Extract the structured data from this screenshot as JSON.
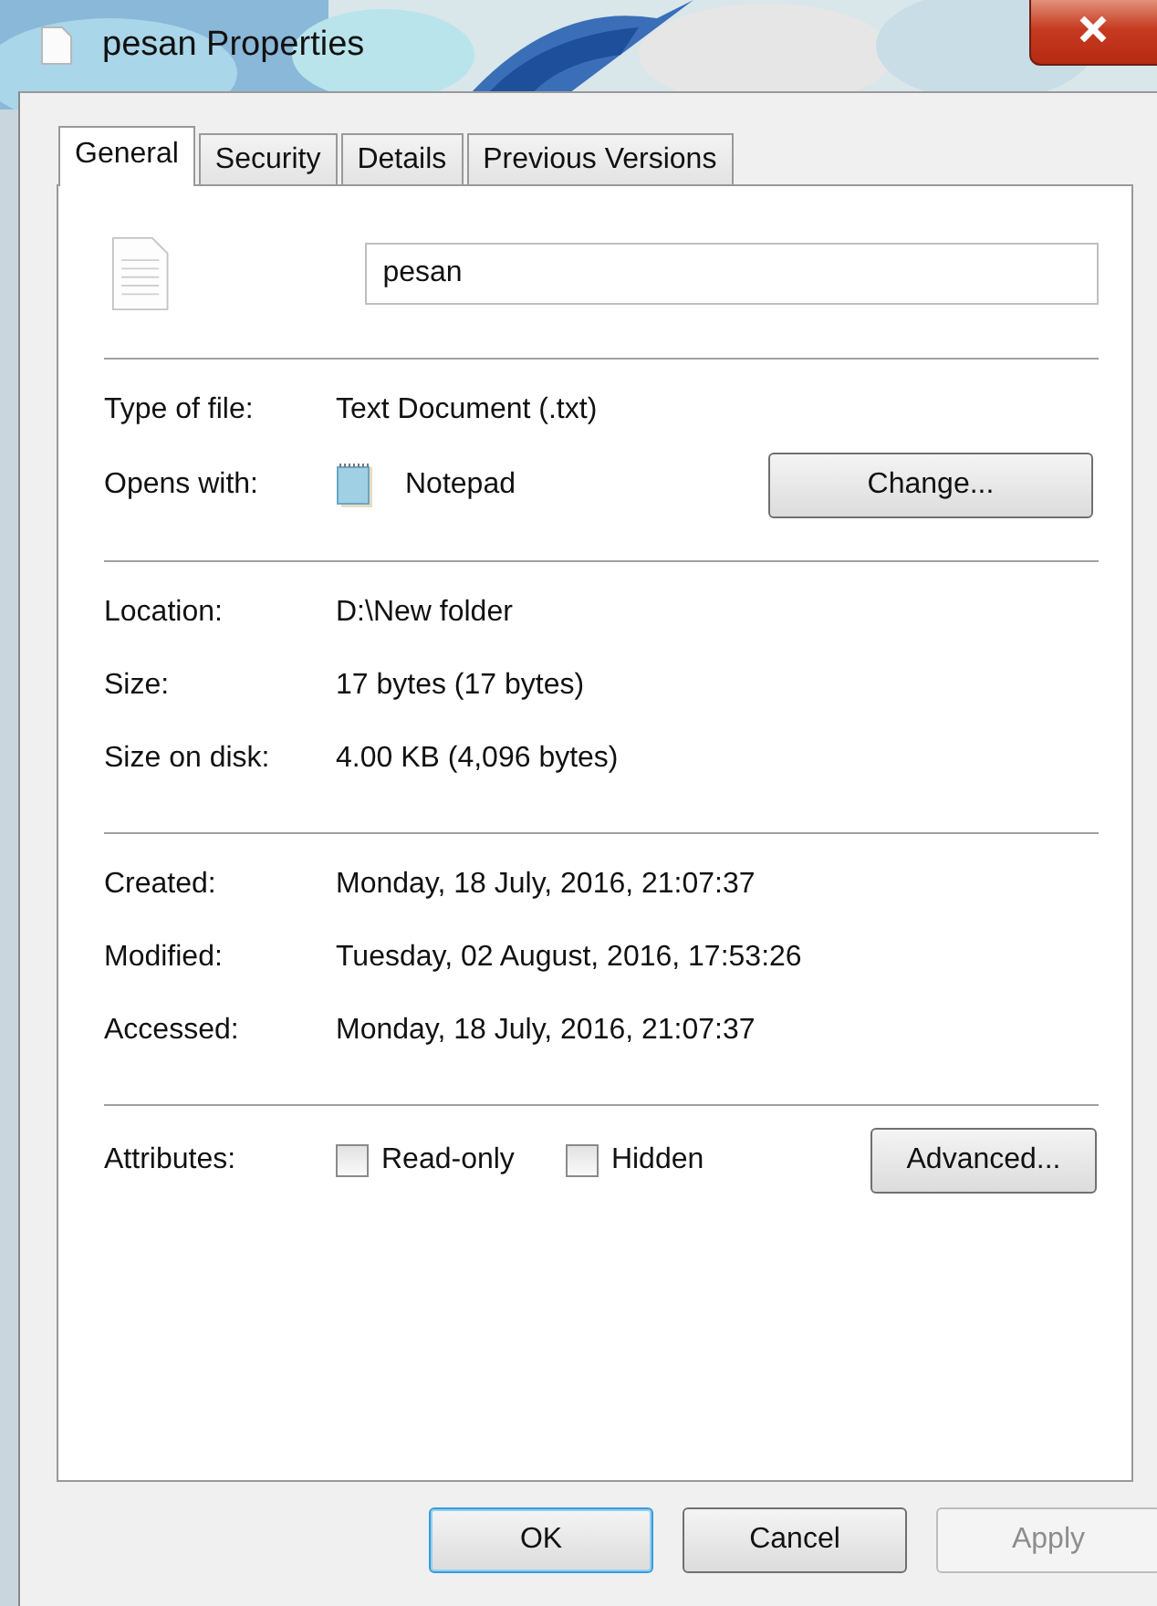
{
  "window": {
    "title": "pesan Properties"
  },
  "tabs": [
    {
      "label": "General",
      "selected": true
    },
    {
      "label": "Security",
      "selected": false
    },
    {
      "label": "Details",
      "selected": false
    },
    {
      "label": "Previous Versions",
      "selected": false
    }
  ],
  "file_name": {
    "value": "pesan"
  },
  "type_of_file": {
    "label": "Type of file:",
    "value": "Text Document (.txt)"
  },
  "opens_with": {
    "label": "Opens with:",
    "value": "Notepad",
    "button": "Change..."
  },
  "location_group": [
    {
      "label": "Location:",
      "value": "D:\\New folder"
    },
    {
      "label": "Size:",
      "value": "17 bytes (17 bytes)"
    },
    {
      "label": "Size on disk:",
      "value": "4.00 KB (4,096 bytes)"
    }
  ],
  "dates_group": [
    {
      "label": "Created:",
      "value": "Monday, 18 July, 2016, 21:07:37"
    },
    {
      "label": "Modified:",
      "value": "Tuesday, 02 August, 2016, 17:53:26"
    },
    {
      "label": "Accessed:",
      "value": "Monday, 18 July, 2016, 21:07:37"
    }
  ],
  "attributes": {
    "label": "Attributes:",
    "checkboxes": [
      {
        "label": "Read-only",
        "checked": false
      },
      {
        "label": "Hidden",
        "checked": false
      }
    ],
    "button": "Advanced..."
  },
  "buttons": [
    {
      "label": "OK",
      "default": true,
      "disabled": false
    },
    {
      "label": "Cancel",
      "default": false,
      "disabled": false
    },
    {
      "label": "Apply",
      "default": false,
      "disabled": true
    }
  ]
}
